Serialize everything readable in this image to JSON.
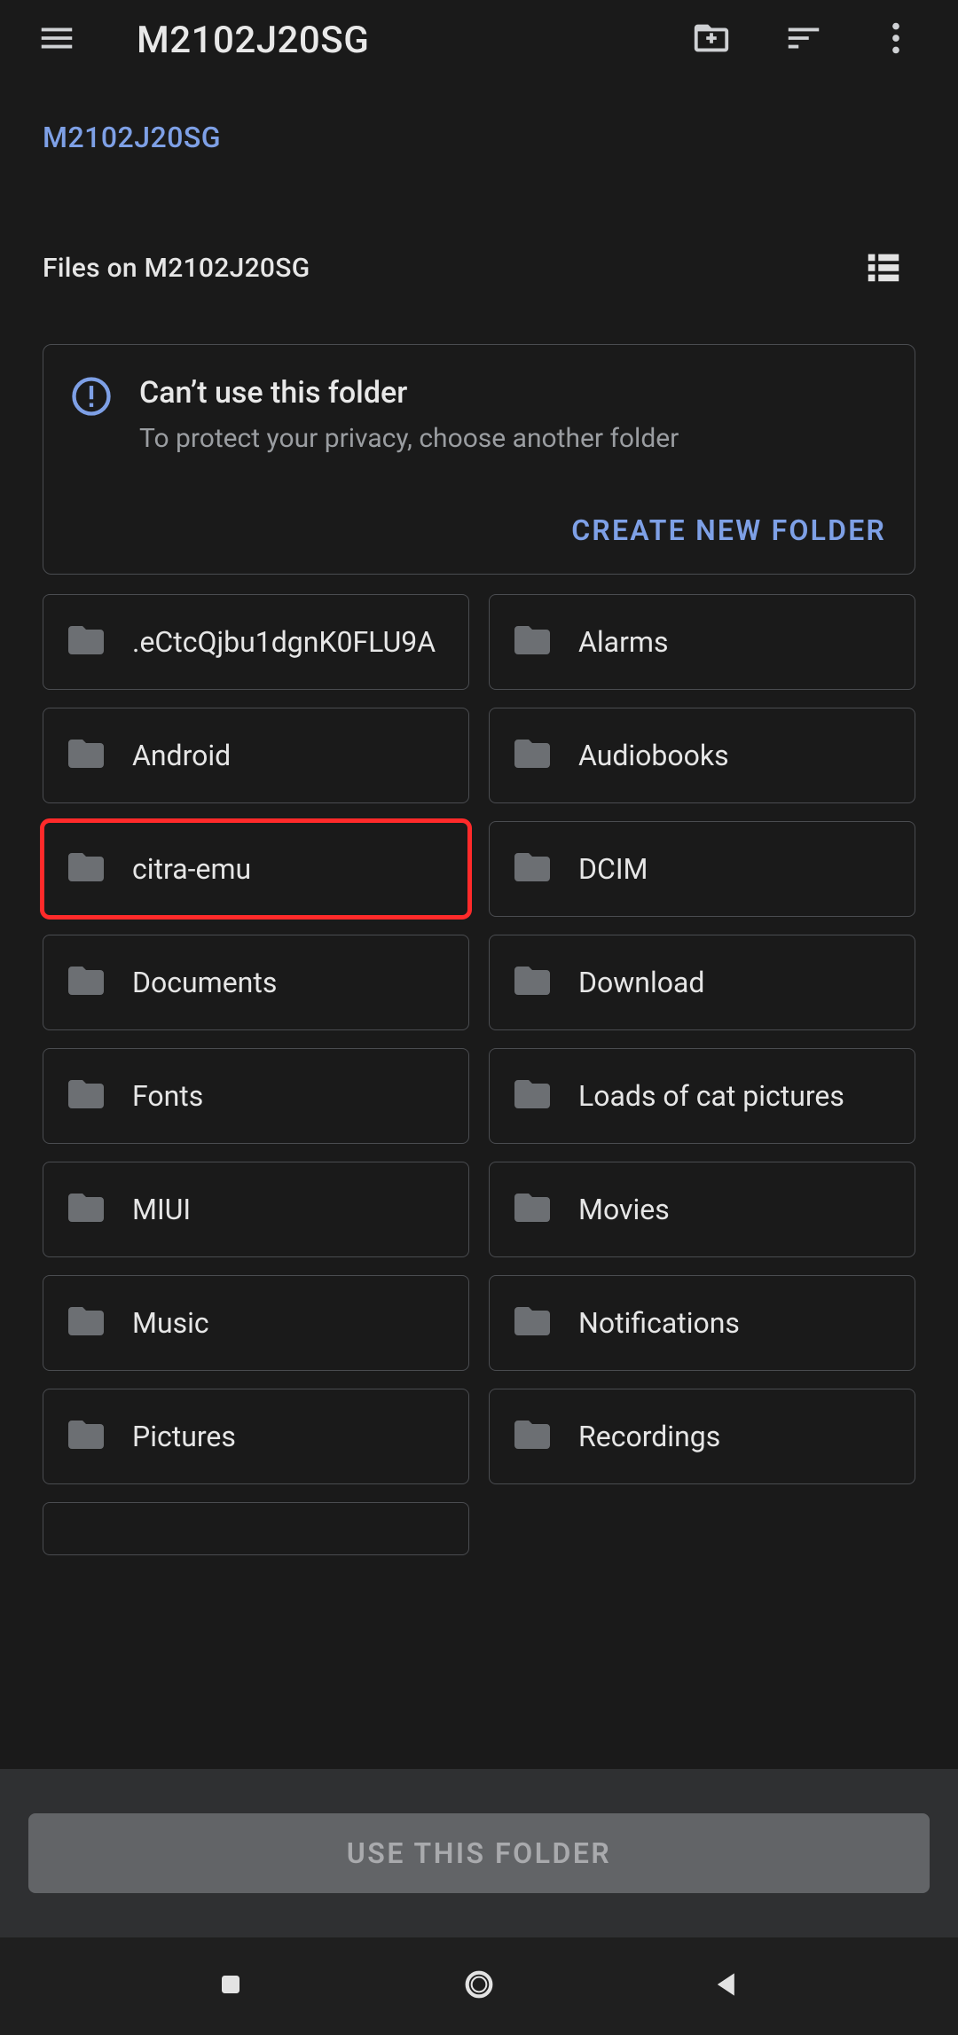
{
  "header": {
    "title": "M2102J20SG"
  },
  "breadcrumb": "M2102J20SG",
  "section": {
    "label": "Files on M2102J20SG"
  },
  "info_card": {
    "title": "Can’t use this folder",
    "subtitle": "To protect your privacy, choose another folder",
    "action_label": "CREATE NEW FOLDER"
  },
  "folders": [
    {
      "name": ".eCtcQjbu1dgnK0FLU9A"
    },
    {
      "name": "Alarms"
    },
    {
      "name": "Android"
    },
    {
      "name": "Audiobooks"
    },
    {
      "name": "citra-emu",
      "highlighted": true
    },
    {
      "name": "DCIM"
    },
    {
      "name": "Documents"
    },
    {
      "name": "Download"
    },
    {
      "name": "Fonts"
    },
    {
      "name": "Loads of cat pictures"
    },
    {
      "name": "MIUI"
    },
    {
      "name": "Movies"
    },
    {
      "name": "Music"
    },
    {
      "name": "Notifications"
    },
    {
      "name": "Pictures"
    },
    {
      "name": "Recordings"
    }
  ],
  "bottom_button": {
    "label": "USE THIS FOLDER"
  },
  "colors": {
    "accent": "#7ea0e6",
    "highlight": "#ff2a2a",
    "bg": "#1a1a1a"
  }
}
